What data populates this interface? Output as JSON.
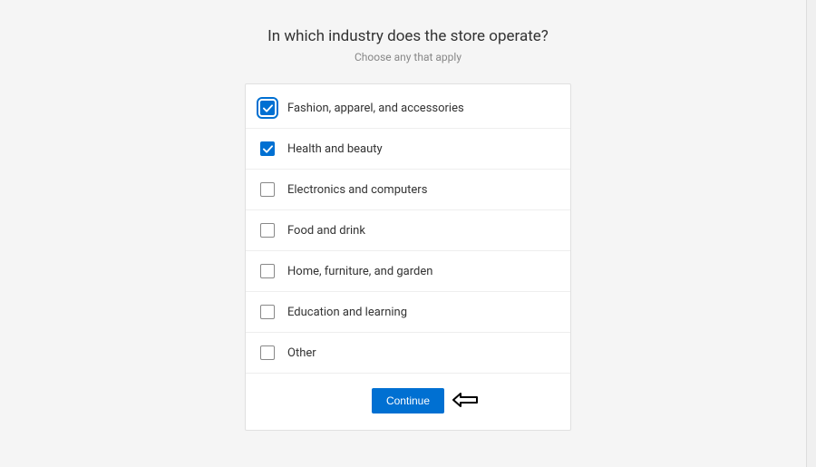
{
  "header": {
    "title": "In which industry does the store operate?",
    "subtitle": "Choose any that apply"
  },
  "options": [
    {
      "label": "Fashion, apparel, and accessories",
      "checked": true,
      "focused": true
    },
    {
      "label": "Health and beauty",
      "checked": true,
      "focused": false
    },
    {
      "label": "Electronics and computers",
      "checked": false,
      "focused": false
    },
    {
      "label": "Food and drink",
      "checked": false,
      "focused": false
    },
    {
      "label": "Home, furniture, and garden",
      "checked": false,
      "focused": false
    },
    {
      "label": "Education and learning",
      "checked": false,
      "focused": false
    },
    {
      "label": "Other",
      "checked": false,
      "focused": false
    }
  ],
  "actions": {
    "continue_label": "Continue"
  }
}
